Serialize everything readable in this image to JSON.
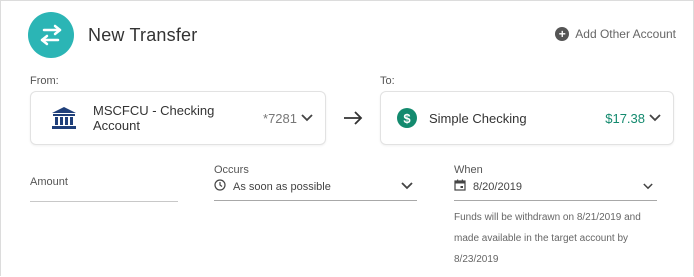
{
  "header": {
    "title": "New Transfer",
    "add_account_label": "Add Other Account"
  },
  "from": {
    "label": "From:",
    "account_name": "MSCFCU - Checking Account",
    "account_number": "*7281"
  },
  "to": {
    "label": "To:",
    "account_name": "Simple Checking",
    "balance": "$17.38"
  },
  "amount": {
    "label": "Amount"
  },
  "occurs": {
    "label": "Occurs",
    "value": "As soon as possible"
  },
  "when": {
    "label": "When",
    "value": "8/20/2019",
    "note": "Funds will be withdrawn on 8/21/2019 and made available in the target account by 8/23/2019"
  },
  "colors": {
    "accent": "#2bb5b5",
    "bank_icon": "#1f3f7a",
    "green": "#138a6e"
  }
}
